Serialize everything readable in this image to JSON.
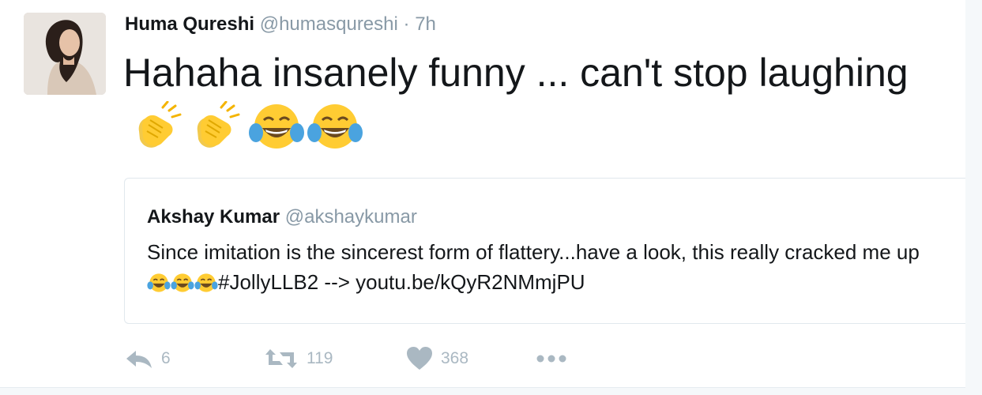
{
  "tweet": {
    "author_name": "Huma Qureshi",
    "author_handle": "@humasqureshi",
    "separator": "·",
    "time": "7h",
    "text": "Hahaha insanely funny ... can't stop laughing",
    "emojis": [
      "clapping-hands",
      "clapping-hands",
      "face-with-tears-of-joy",
      "face-with-tears-of-joy"
    ]
  },
  "quoted_tweet": {
    "author_name": "Akshay Kumar",
    "author_handle": "@akshaykumar",
    "text_before": "Since imitation is the sincerest form of flattery...have a look, this really cracked me up",
    "emojis": [
      "face-with-tears-of-joy",
      "face-with-tears-of-joy",
      "face-with-tears-of-joy"
    ],
    "text_after": "#JollyLLB2 --> youtu.be/kQyR2NMmjPU"
  },
  "actions": {
    "reply_count": "6",
    "retweet_count": "119",
    "like_count": "368",
    "icons": [
      "reply-icon",
      "retweet-icon",
      "heart-icon",
      "more-icon"
    ]
  },
  "colors": {
    "muted": "#8899a6",
    "action_gray": "#aab8c2",
    "border": "#e1e8ed",
    "emoji_yellow": "#ffcc33"
  }
}
